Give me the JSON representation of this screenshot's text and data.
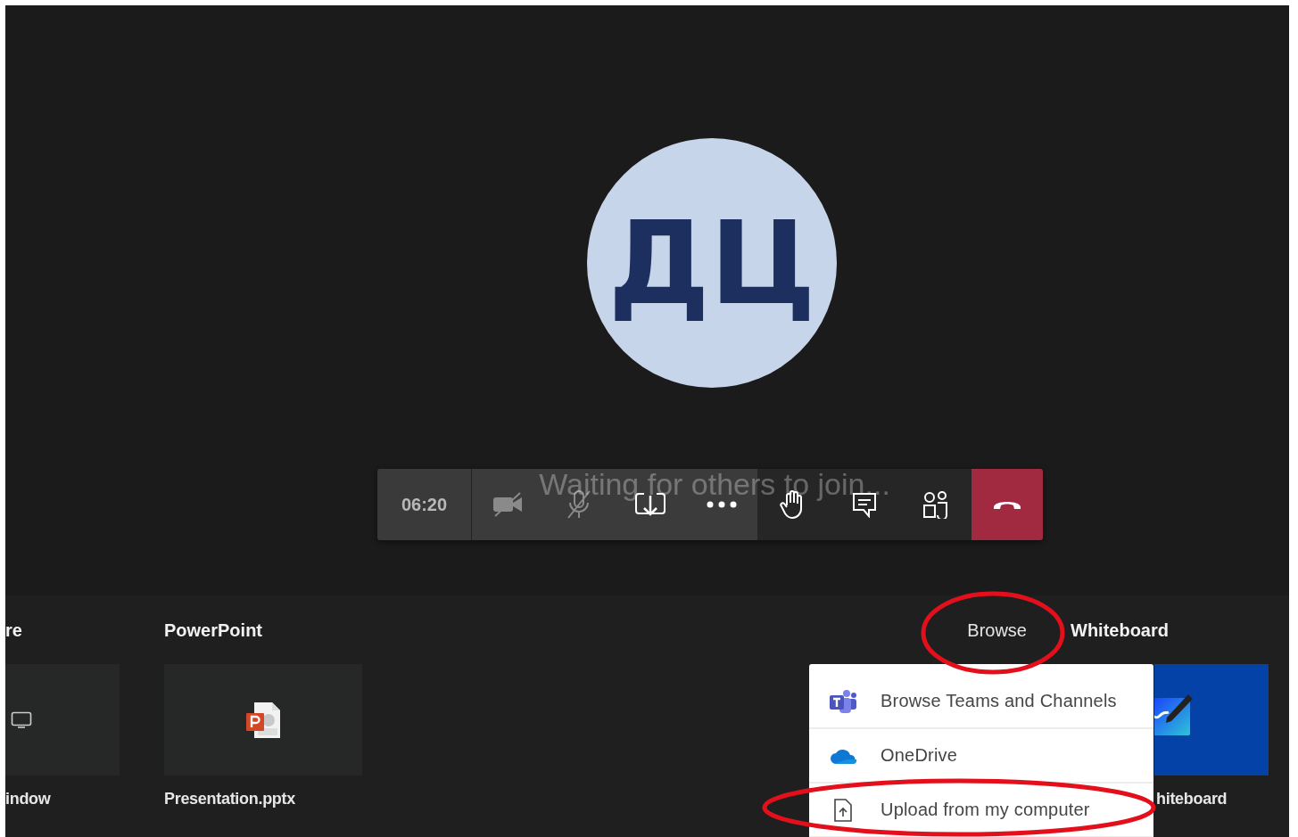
{
  "call": {
    "avatar_initials": "ДЦ",
    "status": "Waiting for others to join..."
  },
  "toolbar": {
    "timer": "06:20",
    "buttons": [
      {
        "kind": "camera",
        "disabled": true
      },
      {
        "kind": "mic",
        "disabled": true
      },
      {
        "kind": "share",
        "disabled": false
      },
      {
        "kind": "more",
        "disabled": false
      },
      {
        "kind": "hand",
        "disabled": false
      },
      {
        "kind": "chat",
        "disabled": false
      },
      {
        "kind": "people",
        "disabled": false
      },
      {
        "kind": "hangup",
        "disabled": false
      }
    ]
  },
  "share_tray": {
    "sections": [
      {
        "heading": "re",
        "tile": {
          "kind": "screen",
          "label": "indow"
        }
      },
      {
        "heading": "PowerPoint",
        "tile": {
          "kind": "pptx",
          "label": "Presentation.pptx"
        }
      }
    ],
    "browse": "Browse",
    "whiteboard": {
      "heading": "Whiteboard",
      "label": "hiteboard"
    },
    "browse_menu": [
      {
        "kind": "teams",
        "label": "Browse Teams and Channels"
      },
      {
        "kind": "onedrive",
        "label": "OneDrive"
      },
      {
        "kind": "upload",
        "label": "Upload from my computer"
      }
    ]
  }
}
